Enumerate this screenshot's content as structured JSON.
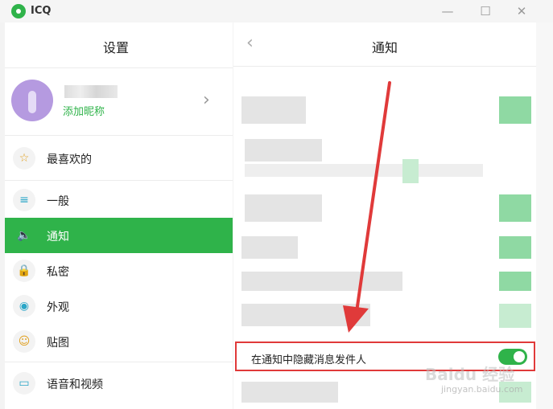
{
  "window": {
    "app_name": "ICQ",
    "minimize_glyph": "—",
    "maximize_glyph": "☐",
    "close_glyph": "✕"
  },
  "left_panel": {
    "title": "设置",
    "profile": {
      "nickname_label": "添加昵称",
      "chevron": "›"
    },
    "nav": [
      {
        "id": "favorites",
        "label": "最喜欢的",
        "icon": "star-icon",
        "glyph": "☆"
      },
      {
        "id": "general",
        "label": "一般",
        "icon": "sliders-icon",
        "glyph": "≡"
      },
      {
        "id": "notifications",
        "label": "通知",
        "icon": "speaker-icon",
        "glyph": "🔈",
        "active": true
      },
      {
        "id": "privacy",
        "label": "私密",
        "icon": "lock-icon",
        "glyph": "🔒"
      },
      {
        "id": "appearance",
        "label": "外观",
        "icon": "palette-icon",
        "glyph": "◉"
      },
      {
        "id": "stickers",
        "label": "贴图",
        "icon": "smiley-icon",
        "glyph": "☺"
      },
      {
        "id": "audio-video",
        "label": "语音和视频",
        "icon": "camera-icon",
        "glyph": "▭"
      }
    ]
  },
  "right_panel": {
    "title": "通知",
    "back": "‹",
    "highlighted_setting": {
      "label": "在通知中隐藏消息发件人",
      "enabled": true
    }
  },
  "colors": {
    "accent": "#2fb34a",
    "annotation": "#e03a3a",
    "nickname": "#2fb34a"
  },
  "watermark": {
    "main": "Baidu 经验",
    "sub": "jingyan.baidu.com"
  }
}
